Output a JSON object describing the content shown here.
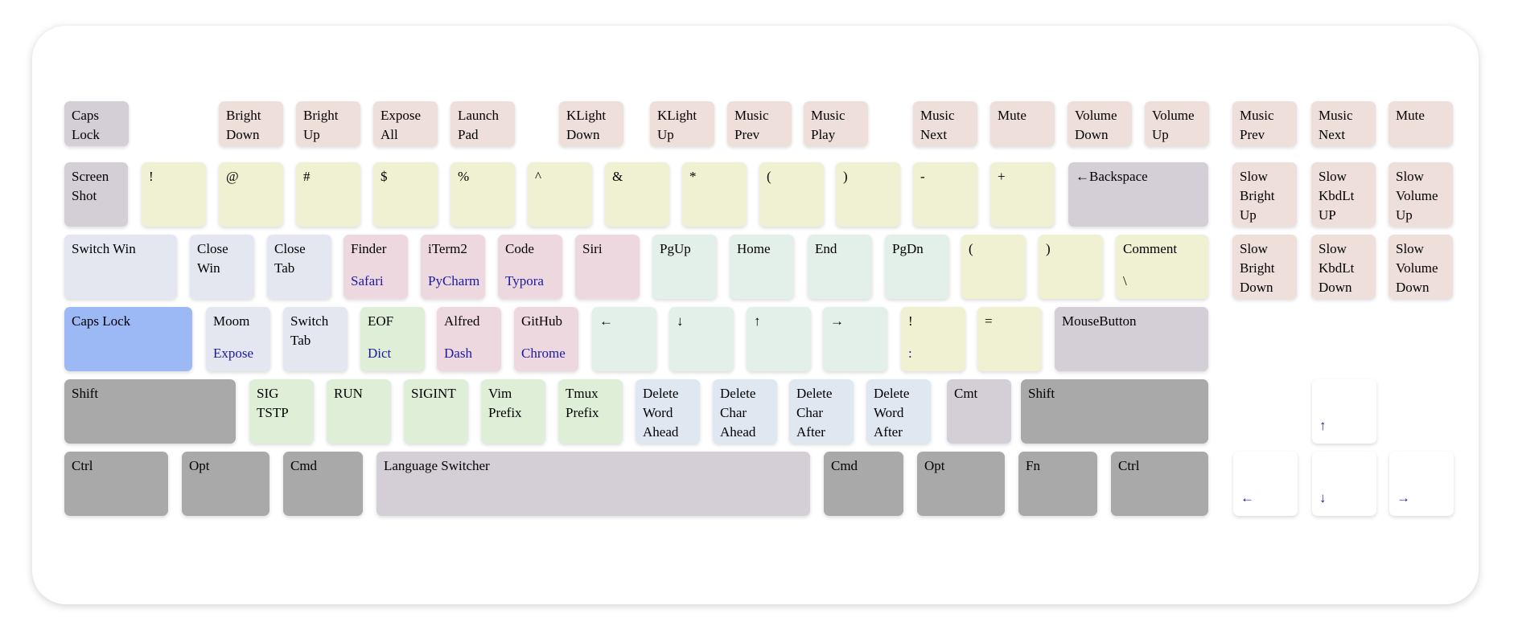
{
  "keyboard": {
    "rows": [
      [
        {
          "label": "Caps\nLock"
        },
        {
          "label": "Bright\nDown"
        },
        {
          "label": "Bright\nUp"
        },
        {
          "label": "Expose\nAll"
        },
        {
          "label": "Launch\nPad"
        },
        {
          "label": "KLight\nDown"
        },
        {
          "label": "KLight\nUp"
        },
        {
          "label": "Music\nPrev"
        },
        {
          "label": "Music\nPlay"
        },
        {
          "label": "Music\nNext"
        },
        {
          "label": "Mute"
        },
        {
          "label": "Volume\nDown"
        },
        {
          "label": "Volume\nUp"
        },
        {
          "label": "Music\nPrev"
        },
        {
          "label": "Music\nNext"
        },
        {
          "label": "Mute"
        }
      ],
      [
        {
          "label": "Screen\nShot"
        },
        {
          "label": "!"
        },
        {
          "label": "@"
        },
        {
          "label": "#"
        },
        {
          "label": "$"
        },
        {
          "label": "%"
        },
        {
          "label": "^"
        },
        {
          "label": "&"
        },
        {
          "label": "*"
        },
        {
          "label": "("
        },
        {
          "label": ")"
        },
        {
          "label": "-"
        },
        {
          "label": "+"
        },
        {
          "label": "←Backspace"
        },
        {
          "label": "Slow\nBright\nUp"
        },
        {
          "label": "Slow\nKbdLt\nUP"
        },
        {
          "label": "Slow\nVolume\nUp"
        }
      ],
      [
        {
          "label": "Switch Win"
        },
        {
          "label": "Close\nWin"
        },
        {
          "label": "Close\nTab"
        },
        {
          "label": "Finder",
          "sub": "Safari"
        },
        {
          "label": "iTerm2",
          "sub": "PyCharm"
        },
        {
          "label": "Code",
          "sub": "Typora"
        },
        {
          "label": "Siri"
        },
        {
          "label": "PgUp"
        },
        {
          "label": "Home"
        },
        {
          "label": "End"
        },
        {
          "label": "PgDn"
        },
        {
          "label": "("
        },
        {
          "label": ")"
        },
        {
          "label": "Comment",
          "sub": "\\"
        },
        {
          "label": "Slow\nBright\nDown"
        },
        {
          "label": "Slow\nKbdLt\nDown"
        },
        {
          "label": "Slow\nVolume\nDown"
        }
      ],
      [
        {
          "label": "Caps Lock"
        },
        {
          "label": "Moom",
          "sub": "Expose"
        },
        {
          "label": "Switch\nTab"
        },
        {
          "label": "EOF",
          "sub": "Dict"
        },
        {
          "label": "Alfred",
          "sub": "Dash"
        },
        {
          "label": "GitHub",
          "sub": "Chrome"
        },
        {
          "label": "←"
        },
        {
          "label": "↓"
        },
        {
          "label": "↑"
        },
        {
          "label": "→"
        },
        {
          "label": "!",
          "sub": ":"
        },
        {
          "label": "="
        },
        {
          "label": "MouseButton"
        }
      ],
      [
        {
          "label": "Shift"
        },
        {
          "label": "SIG\nTSTP"
        },
        {
          "label": "RUN"
        },
        {
          "label": "SIGINT"
        },
        {
          "label": "Vim\nPrefix"
        },
        {
          "label": "Tmux\nPrefix"
        },
        {
          "label": "Delete\nWord\nAhead"
        },
        {
          "label": "Delete\nChar\nAhead"
        },
        {
          "label": "Delete\nChar\nAfter"
        },
        {
          "label": "Delete\nWord\nAfter"
        },
        {
          "label": "Cmt"
        },
        {
          "label": "Shift"
        },
        {
          "label": "",
          "sub": "↑"
        }
      ],
      [
        {
          "label": "Ctrl"
        },
        {
          "label": "Opt"
        },
        {
          "label": "Cmd"
        },
        {
          "label": "Language Switcher"
        },
        {
          "label": "Cmd"
        },
        {
          "label": "Opt"
        },
        {
          "label": "Fn"
        },
        {
          "label": "Ctrl"
        },
        {
          "label": "",
          "sub": "←"
        },
        {
          "label": "",
          "sub": "↓"
        },
        {
          "label": "",
          "sub": "→"
        }
      ]
    ]
  }
}
